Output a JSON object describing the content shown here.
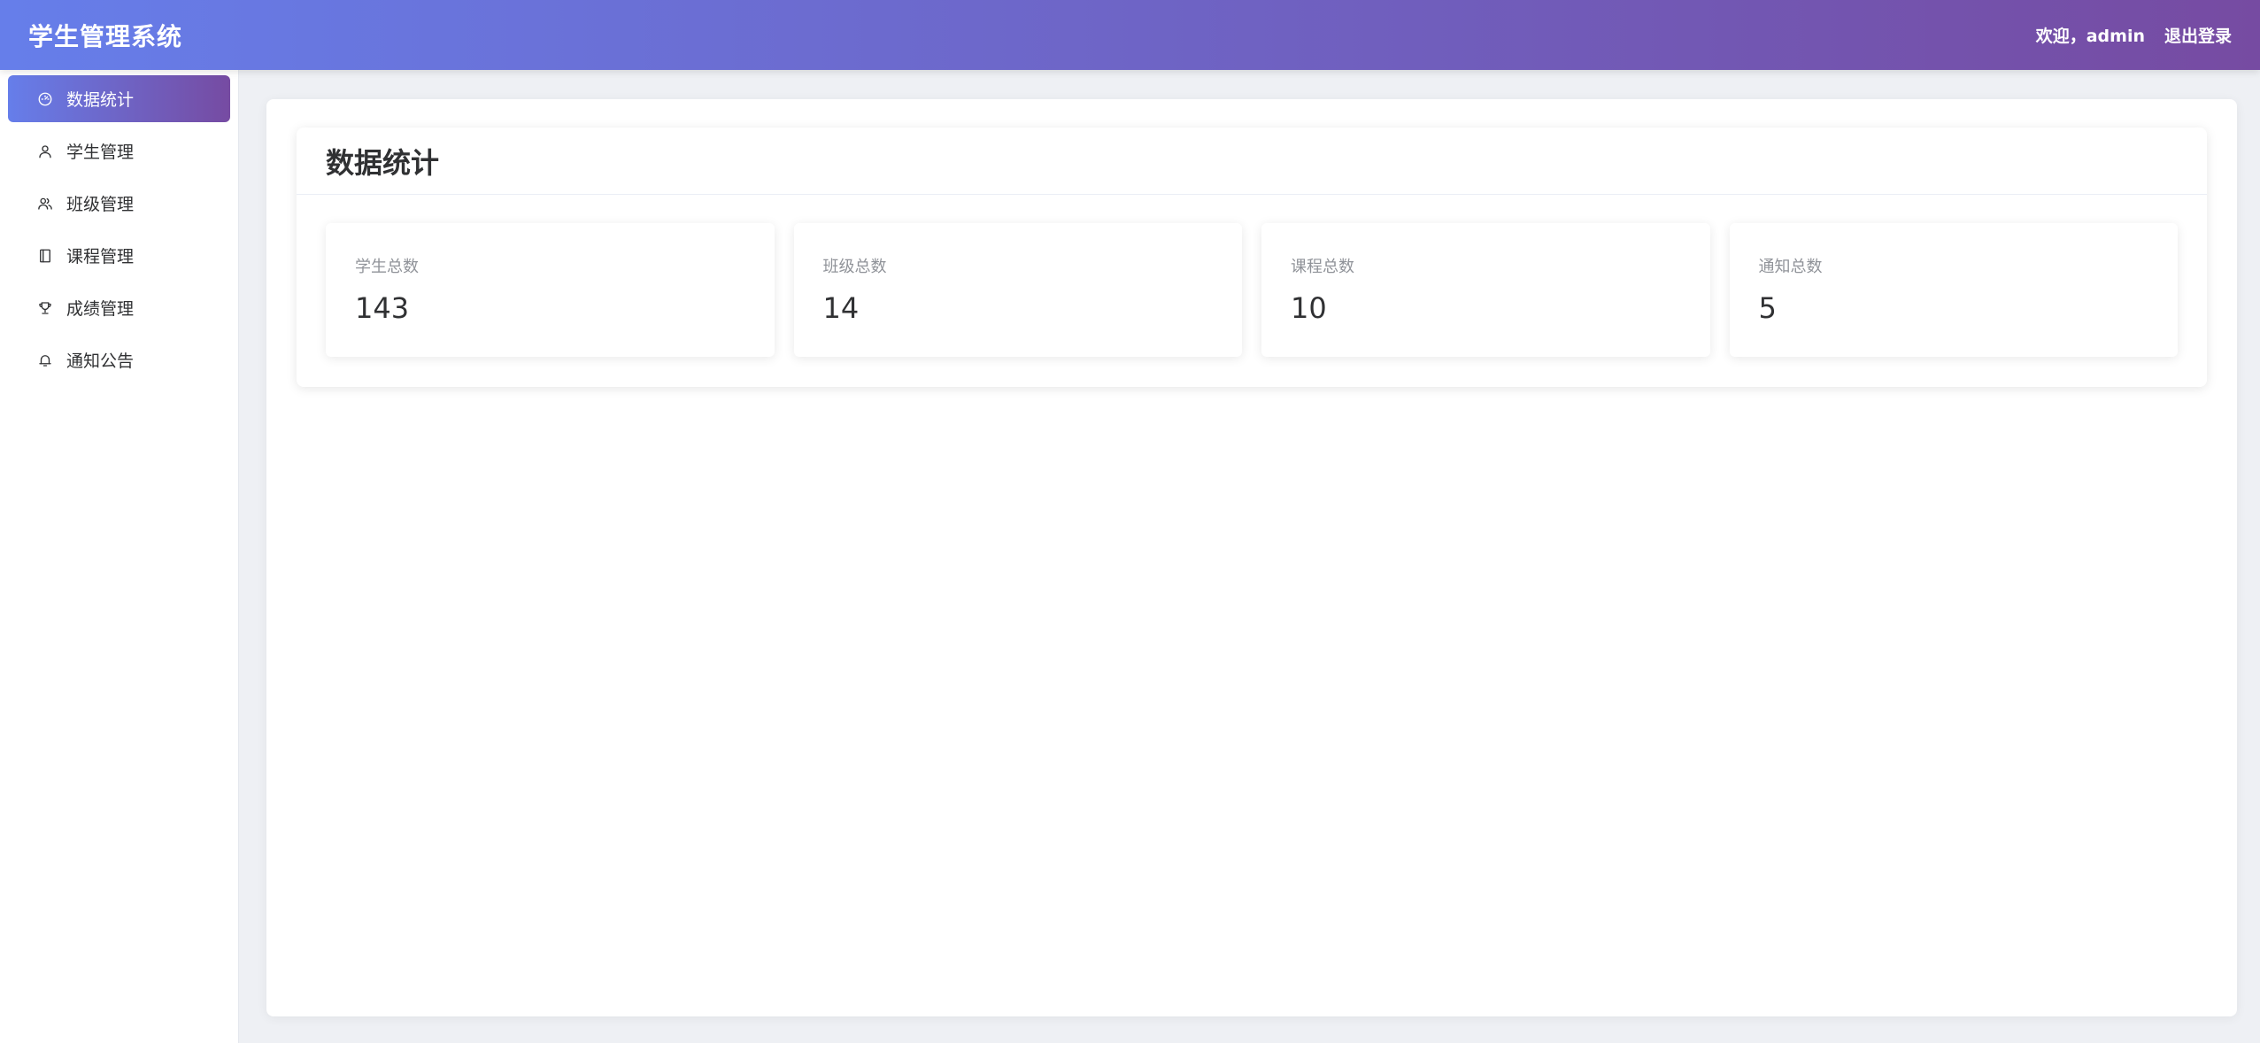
{
  "header": {
    "title": "学生管理系统",
    "welcome_prefix": "欢迎，",
    "username": "admin",
    "logout_label": "退出登录"
  },
  "sidebar": {
    "items": [
      {
        "label": "数据统计",
        "icon": "dashboard-icon",
        "active": true
      },
      {
        "label": "学生管理",
        "icon": "user-icon",
        "active": false
      },
      {
        "label": "班级管理",
        "icon": "user-group-icon",
        "active": false
      },
      {
        "label": "课程管理",
        "icon": "notebook-icon",
        "active": false
      },
      {
        "label": "成绩管理",
        "icon": "trophy-icon",
        "active": false
      },
      {
        "label": "通知公告",
        "icon": "bell-icon",
        "active": false
      }
    ]
  },
  "main": {
    "title": "数据统计",
    "stats": [
      {
        "label": "学生总数",
        "value": "143"
      },
      {
        "label": "班级总数",
        "value": "14"
      },
      {
        "label": "课程总数",
        "value": "10"
      },
      {
        "label": "通知总数",
        "value": "5"
      }
    ]
  },
  "colors": {
    "gradient_start": "#667eea",
    "gradient_end": "#764ba2"
  }
}
